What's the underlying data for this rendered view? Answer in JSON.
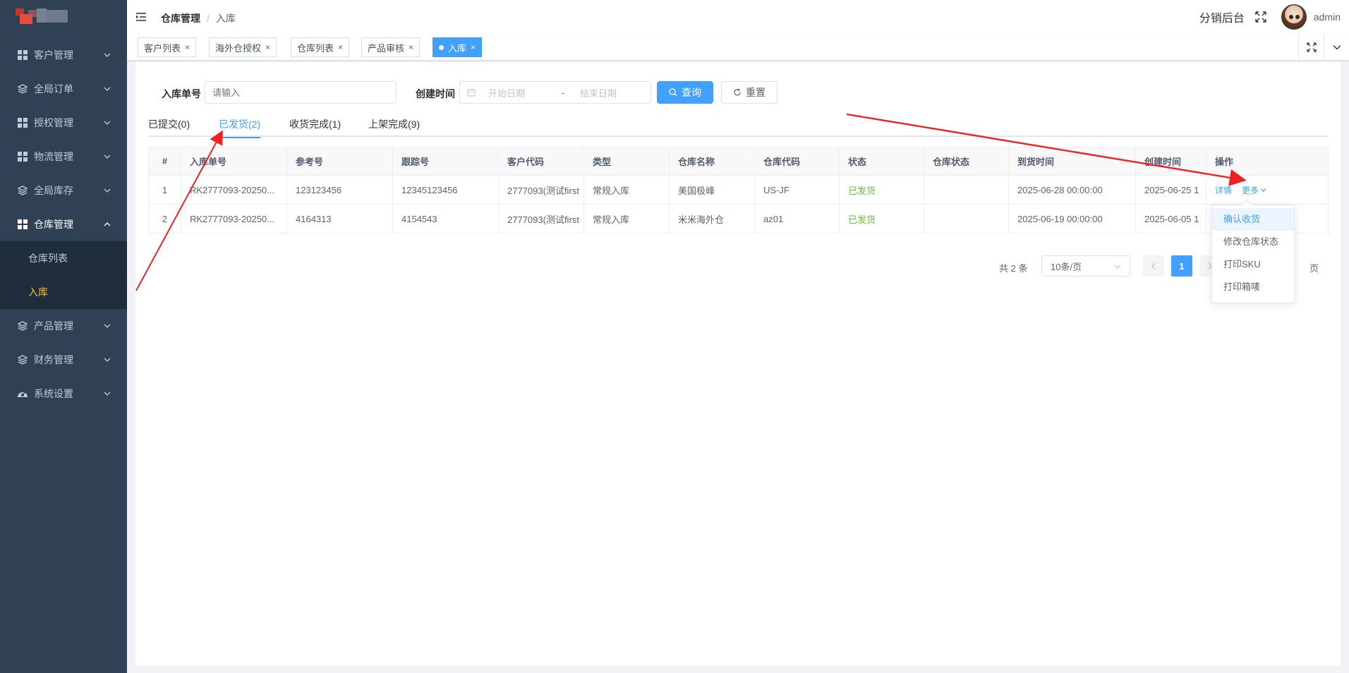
{
  "sidebar": {
    "menu": [
      {
        "label": "客户管理",
        "icon": "grid-icon"
      },
      {
        "label": "全局订单",
        "icon": "layers-icon"
      },
      {
        "label": "授权管理",
        "icon": "grid-icon"
      },
      {
        "label": "物流管理",
        "icon": "grid-icon"
      },
      {
        "label": "全局库存",
        "icon": "layers-icon"
      },
      {
        "label": "仓库管理",
        "icon": "grid-icon"
      },
      {
        "label": "产品管理",
        "icon": "layers-icon"
      },
      {
        "label": "财务管理",
        "icon": "layers-icon"
      },
      {
        "label": "系统设置",
        "icon": "dashboard-icon"
      }
    ],
    "submenu": [
      {
        "label": "仓库列表"
      },
      {
        "label": "入库"
      }
    ],
    "active_color": "#ffb938"
  },
  "header": {
    "breadcrumb": [
      "仓库管理",
      "入库"
    ],
    "title": "分销后台",
    "username": "admin"
  },
  "tags": [
    {
      "label": "客户列表",
      "close": "×"
    },
    {
      "label": "海外仓授权",
      "close": "×"
    },
    {
      "label": "仓库列表",
      "close": "×"
    },
    {
      "label": "产品审核",
      "close": "×"
    },
    {
      "label": "入库",
      "close": "×",
      "active": true
    }
  ],
  "search": {
    "order_label": "入库单号",
    "order_placeholder": "请输入",
    "time_label": "创建时间",
    "start_placeholder": "开始日期",
    "range_sep": "-",
    "end_placeholder": "结束日期",
    "query_label": "查询",
    "reset_label": "重置"
  },
  "tabs": [
    {
      "label": "已提交(0)"
    },
    {
      "label": "已发货(2)",
      "active": true
    },
    {
      "label": "收货完成(1)"
    },
    {
      "label": "上架完成(9)"
    }
  ],
  "table": {
    "columns": [
      "#",
      "入库单号",
      "参考号",
      "跟踪号",
      "客户代码",
      "类型",
      "仓库名称",
      "仓库代码",
      "状态",
      "仓库状态",
      "到货时间",
      "创建时间",
      "操作"
    ],
    "rows": [
      {
        "idx": "1",
        "order_no": "RK2777093-20250...",
        "ref": "123123456",
        "tracking": "12345123456",
        "customer": "2777093(测试first",
        "type": "常规入库",
        "warehouse": "美国极峰",
        "wh_code": "US-JF",
        "status": "已发货",
        "wh_status": "",
        "arrival": "2025-06-28 00:00:00",
        "created": "2025-06-25 1"
      },
      {
        "idx": "2",
        "order_no": "RK2777093-20250...",
        "ref": "4164313",
        "tracking": "4154543",
        "customer": "2777093(测试first",
        "type": "常规入库",
        "warehouse": "米米海外仓",
        "wh_code": "az01",
        "status": "已发货",
        "wh_status": "",
        "arrival": "2025-06-19 00:00:00",
        "created": "2025-06-05 1"
      }
    ],
    "op_detail": "详情",
    "op_more": "更多"
  },
  "dropdown": {
    "items": [
      "确认收货",
      "修改仓库状态",
      "打印SKU",
      "打印箱唛"
    ]
  },
  "pagination": {
    "total": "共 2 条",
    "page_size": "10条/页",
    "current": "1",
    "suffix": "页"
  },
  "colors": {
    "primary": "#42a0ff",
    "sidebar_bg": "#304156",
    "status_green": "#67c23a",
    "annotation_red": "#ee2222"
  }
}
